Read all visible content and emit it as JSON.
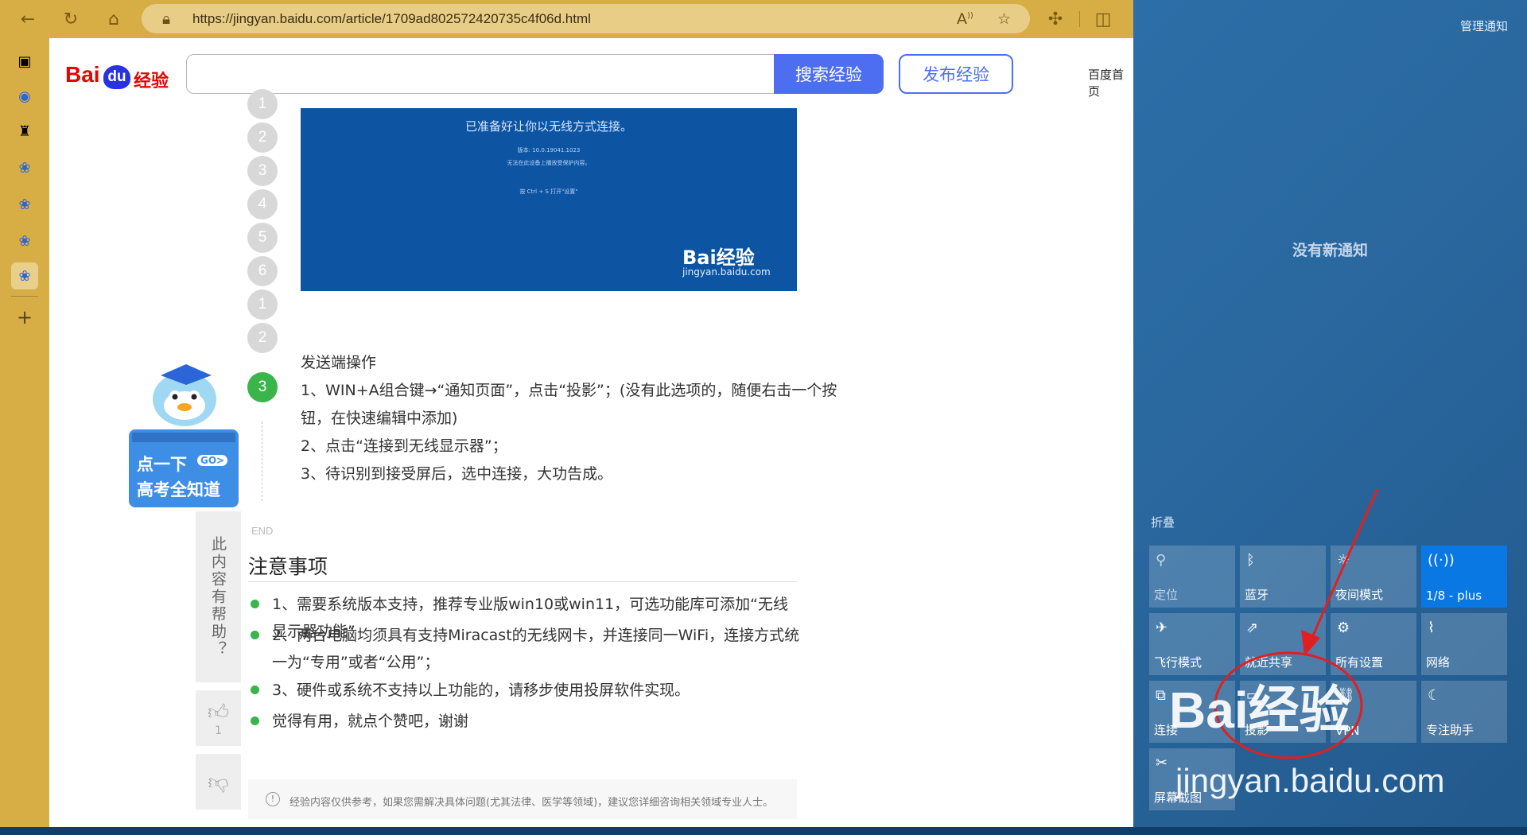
{
  "browser": {
    "url": "https://jingyan.baidu.com/article/1709ad802572420735c4f06d.html",
    "icons": [
      "back-icon",
      "refresh-icon",
      "home-icon",
      "lock-icon",
      "read-aloud-icon",
      "favorite-icon",
      "extensions-icon",
      "split-screen-icon"
    ]
  },
  "page": {
    "logo_bai": "Bai",
    "logo_du": "du",
    "logo_jingyan": "经验",
    "search_placeholder": "",
    "search_button": "搜索经验",
    "publish_button": "发布经验",
    "home_link": "百度首页",
    "screenshot": {
      "line1": "已准备好让你以无线方式连接。",
      "line2": "版本: 10.0.19041.1023",
      "line3": "无法在此设备上播放受保护内容。",
      "line4": "按 Ctrl + S 打开\"设置\"",
      "watermark": "Bai经验",
      "watermark_url": "jingyan.baidu.com"
    },
    "steps_top": [
      "1",
      "2",
      "3",
      "4",
      "5",
      "6"
    ],
    "steps_bottom": [
      "1",
      "2",
      "3"
    ],
    "end_label": "END",
    "step_content": {
      "heading": "发送端操作",
      "line1a": "1、WIN+A组合键→“通知页面”，点击“投影”；(没有此选项的，随便右击一个按",
      "line1b": "钮，在快速编辑中添加)",
      "line2": "2、点击“连接到无线显示器”；",
      "line3": "3、待识别到接受屏后，选中连接，大功告成。"
    },
    "mascot": {
      "line1": "点一下",
      "go": "GO>",
      "line2": "高考全知道"
    },
    "help": {
      "question": "此内容有帮助？",
      "like_count": "1"
    },
    "notes": {
      "title": "注意事项",
      "items": [
        "1、需要系统版本支持，推荐专业版win10或win11，可选功能库可添加“无线显示器功能”",
        "2、两台电脑均须具有支持Miracast的无线网卡，并连接同一WiFi，连接方式统一为“专用”或者“公用”；",
        "3、硬件或系统不支持以上功能的，请移步使用投屏软件实现。",
        "觉得有用，就点个赞吧，谢谢"
      ]
    },
    "disclaimer": "经验内容仅供参考，如果您需解决具体问题(尤其法律、医学等领域)，建议您详细咨询相关领域专业人士。"
  },
  "action_center": {
    "manage": "管理通知",
    "empty": "没有新通知",
    "collapse": "折叠",
    "tiles": [
      {
        "label": "定位",
        "icon": "location-icon",
        "on": false,
        "dim": true
      },
      {
        "label": "蓝牙",
        "icon": "bluetooth-icon",
        "on": false
      },
      {
        "label": "夜间模式",
        "icon": "night-light-icon",
        "on": false
      },
      {
        "label": "1/8 - plus",
        "icon": "wifi-icon",
        "on": true
      },
      {
        "label": "飞行模式",
        "icon": "airplane-icon",
        "on": false
      },
      {
        "label": "就近共享",
        "icon": "nearby-share-icon",
        "on": false
      },
      {
        "label": "所有设置",
        "icon": "settings-icon",
        "on": false
      },
      {
        "label": "网络",
        "icon": "network-icon",
        "on": false
      },
      {
        "label": "连接",
        "icon": "connect-icon",
        "on": false
      },
      {
        "label": "投影",
        "icon": "project-icon",
        "on": false
      },
      {
        "label": "VPN",
        "icon": "vpn-icon",
        "on": false
      },
      {
        "label": "专注助手",
        "icon": "focus-assist-icon",
        "on": false
      },
      {
        "label": "屏幕截图",
        "icon": "screenshot-icon",
        "on": false
      }
    ]
  },
  "watermark": {
    "text": "Bai经验",
    "url": "jingyan.baidu.com"
  },
  "colors": {
    "browser_chrome": "#d7ae45",
    "accent": "#4e6ef2",
    "step_active": "#39b54a",
    "tile_on": "#0a78e2",
    "annotation": "#e02020"
  }
}
